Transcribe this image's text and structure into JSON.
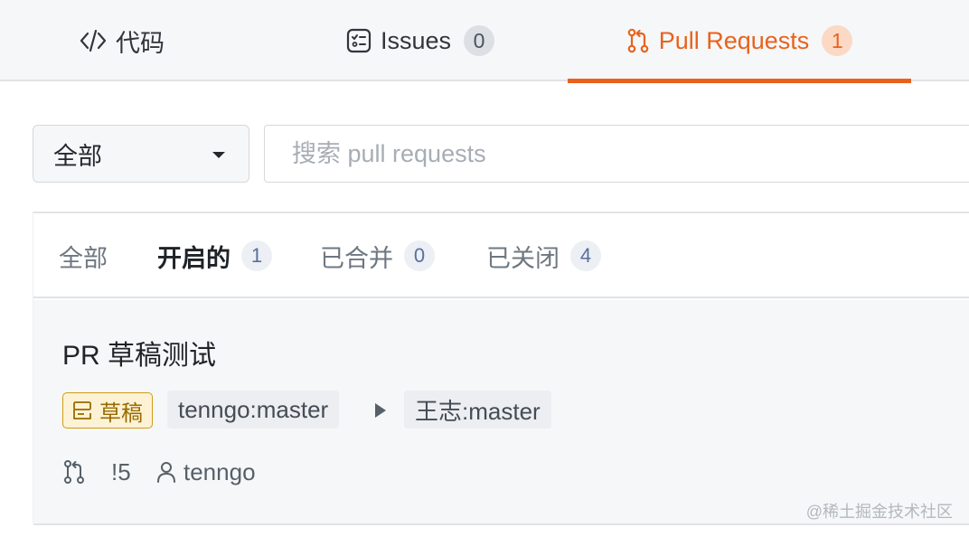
{
  "tabs": {
    "code": {
      "label": "代码",
      "icon": "code-icon"
    },
    "issues": {
      "label": "Issues",
      "count": "0",
      "icon": "issue-icon"
    },
    "pull_requests": {
      "label": "Pull Requests",
      "count": "1",
      "icon": "pull-request-icon",
      "active": true
    }
  },
  "accent_color": "#e9621d",
  "filter": {
    "select_value": "全部",
    "search_placeholder": "搜索 pull requests"
  },
  "state_tabs": [
    {
      "label": "全部"
    },
    {
      "label": "开启的",
      "count": "1",
      "active": true
    },
    {
      "label": "已合并",
      "count": "0"
    },
    {
      "label": "已关闭",
      "count": "4"
    }
  ],
  "pr": {
    "title": "PR 草稿测试",
    "draft_label": "草稿",
    "source_branch": "tenngo:master",
    "target_branch": "王志:master",
    "number": "!5",
    "author": "tenngo"
  },
  "watermark": "@稀土掘金技术社区"
}
